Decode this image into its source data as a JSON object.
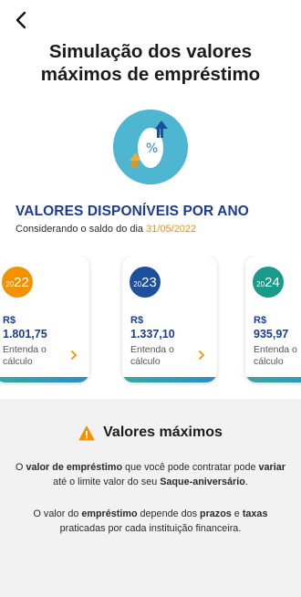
{
  "header": {
    "back_icon": "chevron-left-icon",
    "title_line1": "Simulação dos valores",
    "title_line2": "máximos de empréstimo"
  },
  "hero": {
    "icon": "piggy-percent-icon"
  },
  "section": {
    "title": "VALORES DISPONÍVEIS POR ANO",
    "subtitle_prefix": "Considerando o saldo do dia ",
    "date": "31/05/2022"
  },
  "cards": [
    {
      "year_prefix": "20",
      "year_suffix": "22",
      "currency": "R$",
      "amount": "1.801,75",
      "link": "Entenda o cálculo",
      "color": "#f39200"
    },
    {
      "year_prefix": "20",
      "year_suffix": "23",
      "currency": "R$",
      "amount": "1.337,10",
      "link": "Entenda o cálculo",
      "color": "#1c4f9c"
    },
    {
      "year_prefix": "20",
      "year_suffix": "24",
      "currency": "R$",
      "amount": "935,97",
      "link": "Entenda o cálculo",
      "color": "#1a9a8a"
    }
  ],
  "info": {
    "title": "Valores máximos",
    "p1": {
      "a": "O ",
      "b": "valor de empréstimo",
      "c": " que você pode contratar pode ",
      "d": "variar",
      "e": " até o limite valor do seu ",
      "f": "Saque-aniversário",
      "g": "."
    },
    "p2": {
      "a": "O valor do ",
      "b": "empréstimo",
      "c": " depende dos ",
      "d": "prazos",
      "e": " e ",
      "f": "taxas",
      "g": " praticadas por cada instituição financeira."
    }
  },
  "colors": {
    "brand_blue": "#1c3d8f",
    "accent_orange": "#f39200",
    "hero_bg": "#4fb6d2"
  }
}
